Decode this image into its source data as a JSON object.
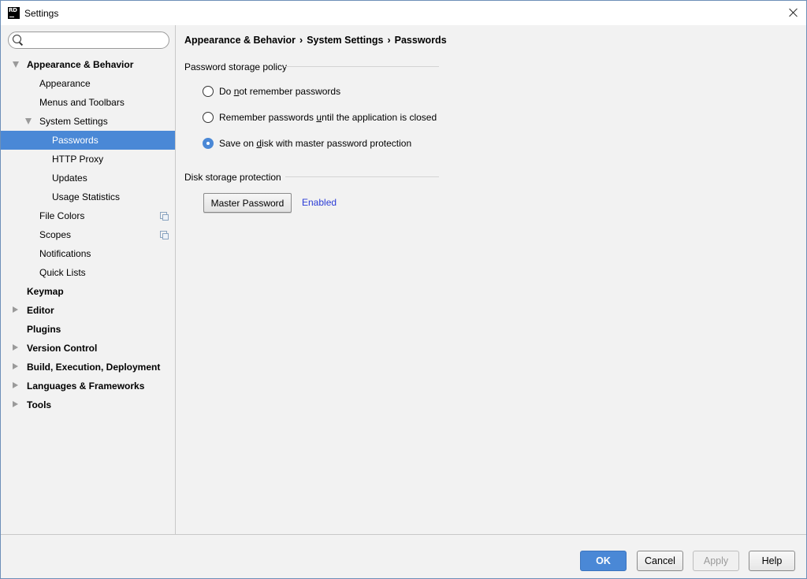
{
  "window": {
    "title": "Settings",
    "app_icon_text": "RD"
  },
  "search": {
    "value": "",
    "placeholder": ""
  },
  "sidebar": {
    "items": [
      {
        "label": "Appearance & Behavior",
        "level": 0,
        "bold": true,
        "arrow": "expanded"
      },
      {
        "label": "Appearance",
        "level": 1
      },
      {
        "label": "Menus and Toolbars",
        "level": 1
      },
      {
        "label": "System Settings",
        "level": 1,
        "arrow": "expanded"
      },
      {
        "label": "Passwords",
        "level": 2,
        "selected": true
      },
      {
        "label": "HTTP Proxy",
        "level": 2
      },
      {
        "label": "Updates",
        "level": 2
      },
      {
        "label": "Usage Statistics",
        "level": 2
      },
      {
        "label": "File Colors",
        "level": 1,
        "project_icon": true
      },
      {
        "label": "Scopes",
        "level": 1,
        "project_icon": true
      },
      {
        "label": "Notifications",
        "level": 1
      },
      {
        "label": "Quick Lists",
        "level": 1
      },
      {
        "label": "Keymap",
        "level": 0,
        "bold": true
      },
      {
        "label": "Editor",
        "level": 0,
        "bold": true,
        "arrow": "collapsed"
      },
      {
        "label": "Plugins",
        "level": 0,
        "bold": true
      },
      {
        "label": "Version Control",
        "level": 0,
        "bold": true,
        "arrow": "collapsed"
      },
      {
        "label": "Build, Execution, Deployment",
        "level": 0,
        "bold": true,
        "arrow": "collapsed"
      },
      {
        "label": "Languages & Frameworks",
        "level": 0,
        "bold": true,
        "arrow": "collapsed"
      },
      {
        "label": "Tools",
        "level": 0,
        "bold": true,
        "arrow": "collapsed"
      }
    ]
  },
  "breadcrumb": {
    "parts": [
      "Appearance & Behavior",
      "System Settings",
      "Passwords"
    ],
    "separator": "›"
  },
  "password_policy": {
    "title": "Password storage policy",
    "options": [
      {
        "pre": "Do ",
        "mnemonic": "n",
        "post": "ot remember passwords",
        "checked": false
      },
      {
        "pre": "Remember passwords ",
        "mnemonic": "u",
        "post": "ntil the application is closed",
        "checked": false
      },
      {
        "pre": "Save on ",
        "mnemonic": "d",
        "post": "isk with master password protection",
        "checked": true
      }
    ]
  },
  "disk_protection": {
    "title": "Disk storage protection",
    "button_label": "Master Password",
    "status": "Enabled"
  },
  "footer": {
    "ok": "OK",
    "cancel": "Cancel",
    "apply": "Apply",
    "help": "Help"
  },
  "colors": {
    "accent": "#4a88d6",
    "link": "#2a3bd6",
    "background": "#f2f2f2"
  }
}
